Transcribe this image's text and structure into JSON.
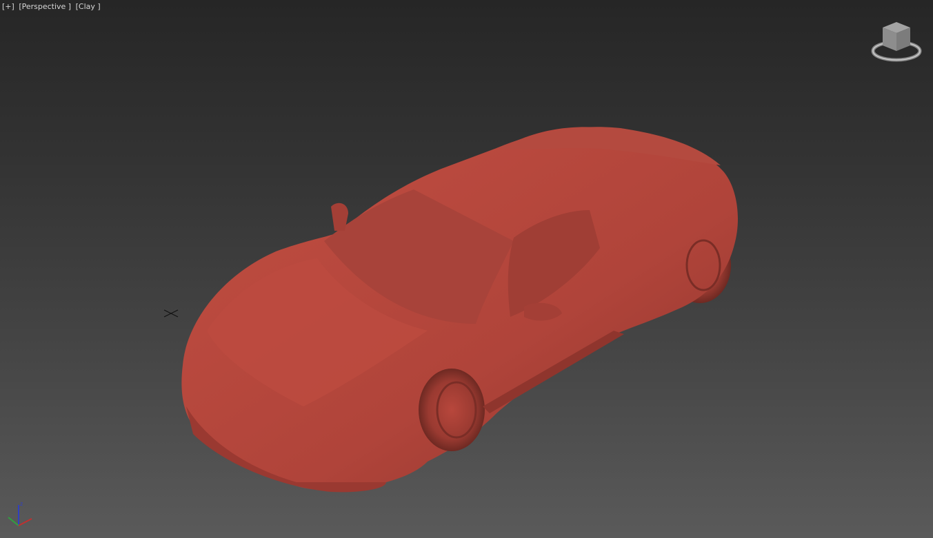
{
  "viewport": {
    "labels": [
      "[+]",
      "[Perspective ]",
      "[Clay ]"
    ],
    "view_name": "Perspective",
    "shading": "Clay"
  },
  "viewcube": {
    "icon": "viewcube-icon"
  },
  "axis_tripod": {
    "z_label": "z",
    "colors": {
      "x": "#c03030",
      "y": "#30a040",
      "z": "#3040c0"
    }
  },
  "colors": {
    "clay": "#b5453b",
    "background_top": "#262626",
    "background_bottom": "#5a5a5a"
  }
}
